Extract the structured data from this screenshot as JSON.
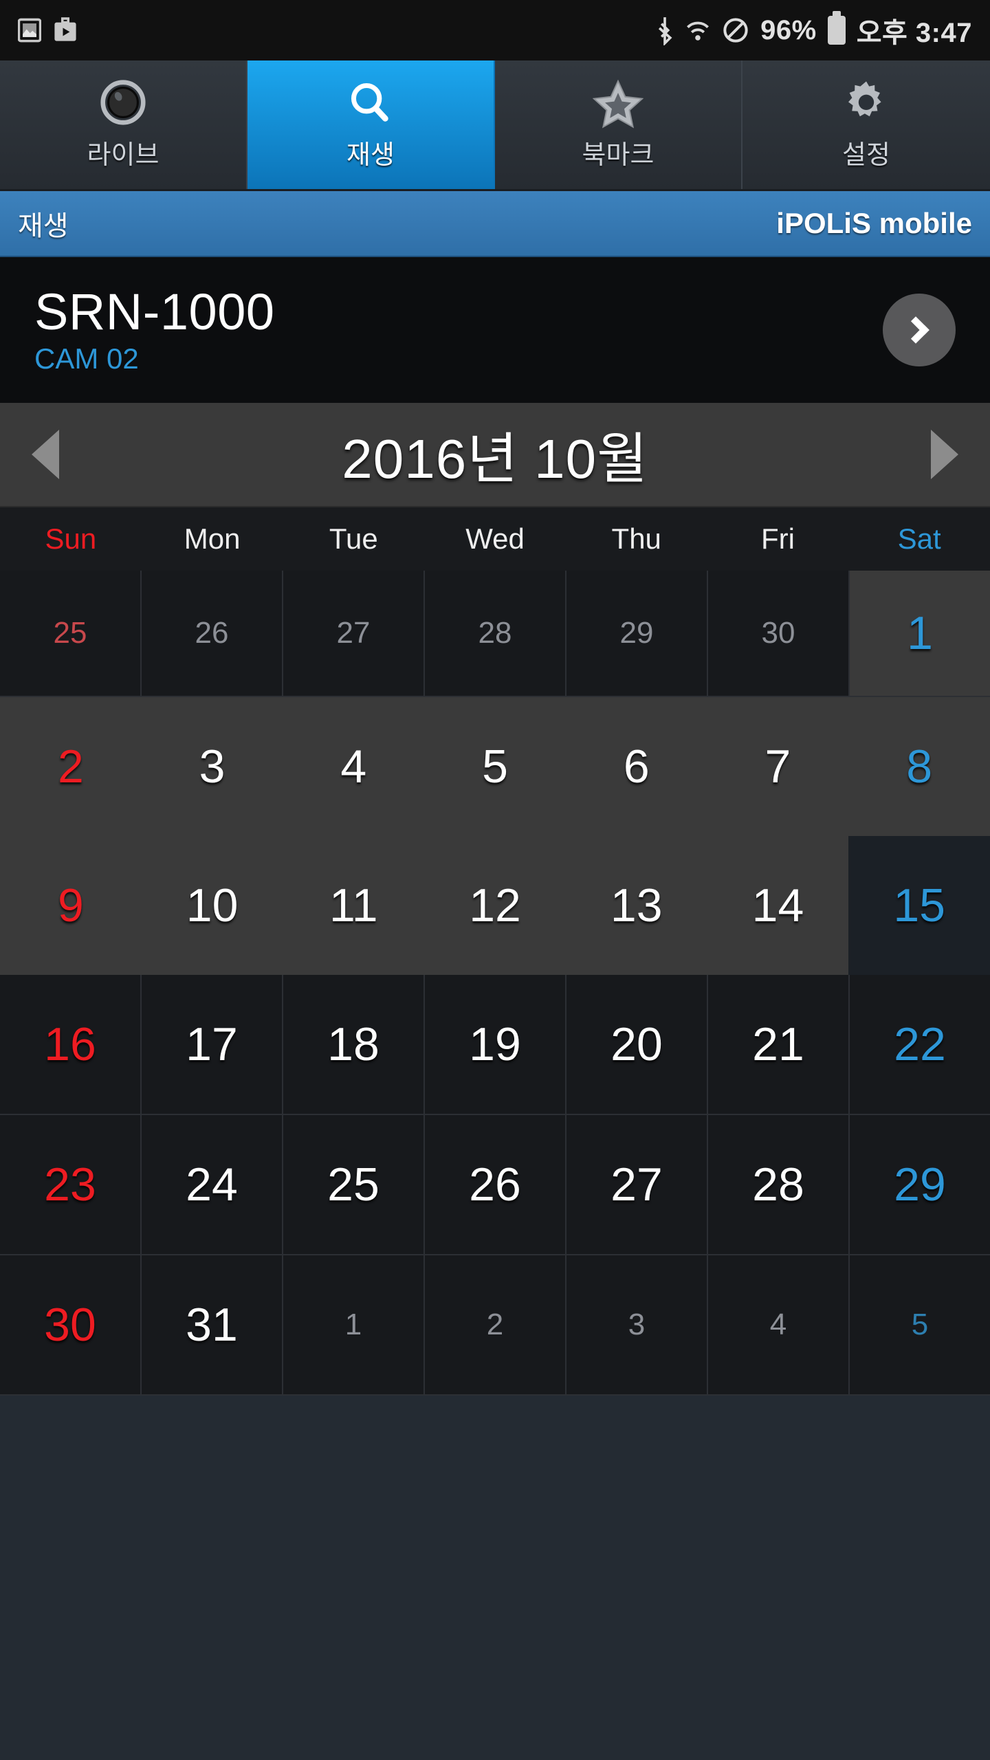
{
  "status_bar": {
    "left_icons": [
      "screenshot-icon",
      "work-media-icon"
    ],
    "right_icons": [
      "bluetooth-icon",
      "wifi-icon",
      "mute-icon",
      "battery-icon"
    ],
    "battery_percent": "96%",
    "time": "오후 3:47"
  },
  "tabs": [
    {
      "label": "라이브",
      "icon": "camera-lens-icon",
      "active": false
    },
    {
      "label": "재생",
      "icon": "search-icon",
      "active": true
    },
    {
      "label": "북마크",
      "icon": "star-icon",
      "active": false
    },
    {
      "label": "설정",
      "icon": "gear-icon",
      "active": false
    }
  ],
  "title_bar": {
    "left": "재생",
    "right": "iPOLiS mobile"
  },
  "device": {
    "name": "SRN-1000",
    "camera": "CAM 02",
    "arrow_icon": "chevron-right-icon"
  },
  "month_nav": {
    "prev_icon": "triangle-left-icon",
    "next_icon": "triangle-right-icon",
    "label": "2016년 10월",
    "year": "2016",
    "month": "10"
  },
  "weekdays": [
    "Sun",
    "Mon",
    "Tue",
    "Wed",
    "Thu",
    "Fri",
    "Sat"
  ],
  "colors": {
    "accent_blue": "#2d97d8",
    "sunday_red": "#ee1c22",
    "saturday_blue": "#2d97d8",
    "titlebar_blue": "#3d82bd",
    "tab_active_blue": "#1ca7ef",
    "page_background": "#242b33"
  },
  "calendar": {
    "selected_day": "15",
    "weeks": [
      [
        {
          "day": "25",
          "month": "prev",
          "type": "sun"
        },
        {
          "day": "26",
          "month": "prev",
          "type": "weekday"
        },
        {
          "day": "27",
          "month": "prev",
          "type": "weekday"
        },
        {
          "day": "28",
          "month": "prev",
          "type": "weekday"
        },
        {
          "day": "29",
          "month": "prev",
          "type": "weekday"
        },
        {
          "day": "30",
          "month": "prev",
          "type": "weekday"
        },
        {
          "day": "1",
          "month": "current",
          "type": "sat"
        }
      ],
      [
        {
          "day": "2",
          "month": "current",
          "type": "sun"
        },
        {
          "day": "3",
          "month": "current",
          "type": "weekday"
        },
        {
          "day": "4",
          "month": "current",
          "type": "weekday"
        },
        {
          "day": "5",
          "month": "current",
          "type": "weekday"
        },
        {
          "day": "6",
          "month": "current",
          "type": "weekday"
        },
        {
          "day": "7",
          "month": "current",
          "type": "weekday"
        },
        {
          "day": "8",
          "month": "current",
          "type": "sat"
        }
      ],
      [
        {
          "day": "9",
          "month": "current",
          "type": "sun"
        },
        {
          "day": "10",
          "month": "current",
          "type": "weekday"
        },
        {
          "day": "11",
          "month": "current",
          "type": "weekday"
        },
        {
          "day": "12",
          "month": "current",
          "type": "weekday"
        },
        {
          "day": "13",
          "month": "current",
          "type": "weekday"
        },
        {
          "day": "14",
          "month": "current",
          "type": "weekday"
        },
        {
          "day": "15",
          "month": "current",
          "type": "sat",
          "selected": true
        }
      ],
      [
        {
          "day": "16",
          "month": "current",
          "type": "sun"
        },
        {
          "day": "17",
          "month": "current",
          "type": "weekday"
        },
        {
          "day": "18",
          "month": "current",
          "type": "weekday"
        },
        {
          "day": "19",
          "month": "current",
          "type": "weekday"
        },
        {
          "day": "20",
          "month": "current",
          "type": "weekday"
        },
        {
          "day": "21",
          "month": "current",
          "type": "weekday"
        },
        {
          "day": "22",
          "month": "current",
          "type": "sat"
        }
      ],
      [
        {
          "day": "23",
          "month": "current",
          "type": "sun"
        },
        {
          "day": "24",
          "month": "current",
          "type": "weekday"
        },
        {
          "day": "25",
          "month": "current",
          "type": "weekday"
        },
        {
          "day": "26",
          "month": "current",
          "type": "weekday"
        },
        {
          "day": "27",
          "month": "current",
          "type": "weekday"
        },
        {
          "day": "28",
          "month": "current",
          "type": "weekday"
        },
        {
          "day": "29",
          "month": "current",
          "type": "sat"
        }
      ],
      [
        {
          "day": "30",
          "month": "current",
          "type": "sun"
        },
        {
          "day": "31",
          "month": "current",
          "type": "weekday"
        },
        {
          "day": "1",
          "month": "next",
          "type": "weekday"
        },
        {
          "day": "2",
          "month": "next",
          "type": "weekday"
        },
        {
          "day": "3",
          "month": "next",
          "type": "weekday"
        },
        {
          "day": "4",
          "month": "next",
          "type": "weekday"
        },
        {
          "day": "5",
          "month": "next",
          "type": "sat"
        }
      ]
    ]
  }
}
